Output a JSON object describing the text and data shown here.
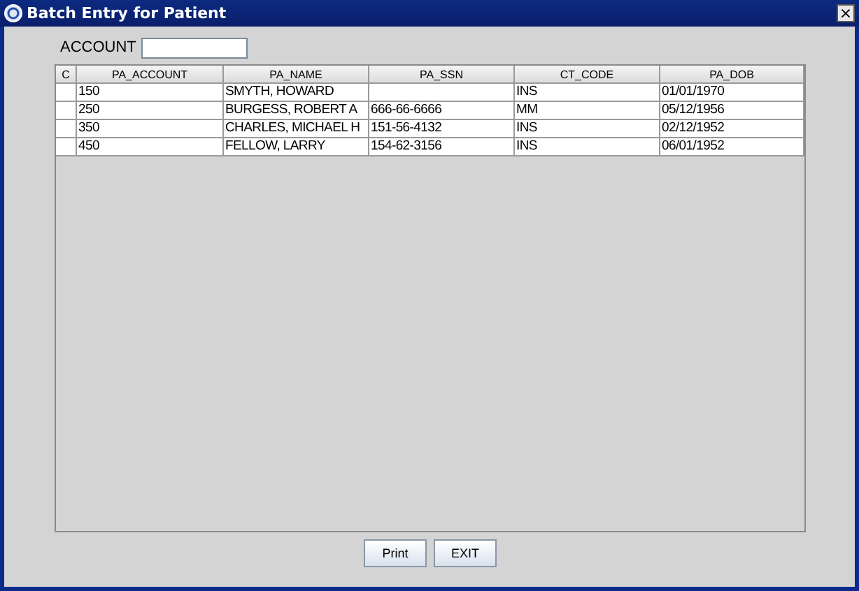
{
  "window": {
    "title": "Batch Entry for Patient",
    "close": "×"
  },
  "account": {
    "label": "ACCOUNT"
  },
  "table": {
    "columns": [
      "C",
      "PA_ACCOUNT",
      "PA_NAME",
      "PA_SSN",
      "CT_CODE",
      "PA_DOB"
    ],
    "rows": [
      [
        null,
        "150",
        "SMYTH, HOWARD",
        null,
        "INS",
        "01/01/1970"
      ],
      [
        null,
        "250",
        "BURGESS, ROBERT A",
        "666-66-6666",
        "MM",
        "05/12/1956"
      ],
      [
        null,
        "350",
        "CHARLES, MICHAEL H",
        "151-56-4132",
        "INS",
        "02/12/1952"
      ],
      [
        null,
        "450",
        "FELLOW, LARRY",
        "154-62-3156",
        "INS",
        "06/01/1952"
      ]
    ]
  },
  "buttons": [
    "Print",
    "EXIT"
  ]
}
